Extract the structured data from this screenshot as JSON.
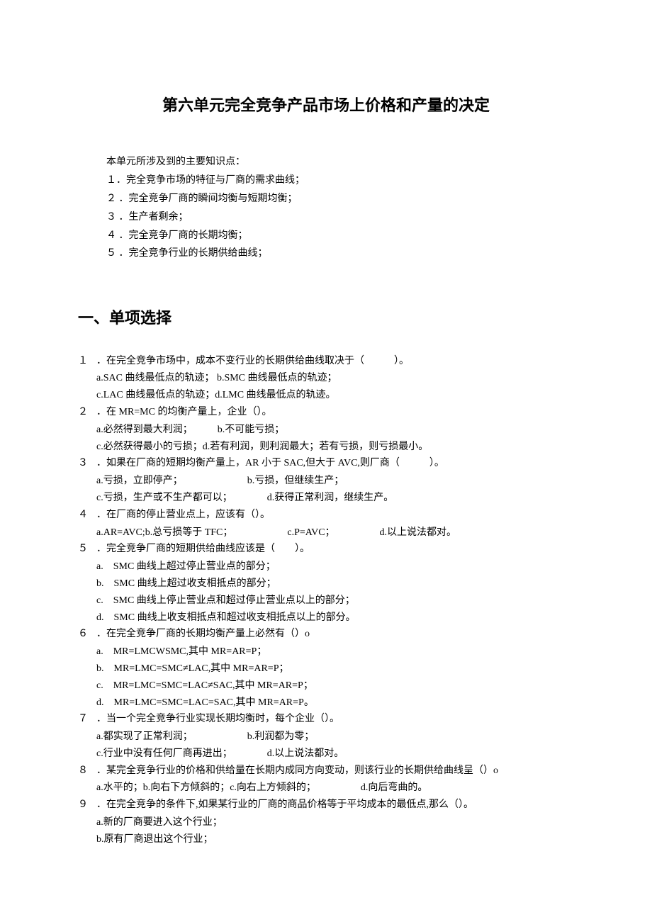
{
  "title": "第六单元完全竞争产品市场上价格和产量的决定",
  "intro": {
    "lead": "本单元所涉及到的主要知识点：",
    "items": [
      "１．完全竞争市场的特征与厂商的需求曲线；",
      "２ ．完全竞争厂商的瞬间均衡与短期均衡；",
      "３ ．生产者剩余；",
      "４ ．完全竞争厂商的长期均衡；",
      "５ ．完全竞争行业的长期供给曲线；"
    ]
  },
  "section_heading": "一、单项选择",
  "questions": [
    {
      "num": "１",
      "stem": "．在完全竞争市场中，成本不变行业的长期供给曲线取决于（　　　）。",
      "opts": [
        "a.SAC 曲线最低点的轨迹； b.SMC 曲线最低点的轨迹；",
        "c.LAC 曲线最低点的轨迹；d.LMC 曲线最低点的轨迹。"
      ]
    },
    {
      "num": "２",
      "stem": "．在 MR=MC 的均衡产量上，企业（）。",
      "opts": [
        "a.必然得到最大利润；　　　b.不可能亏损；",
        "c.必然获得最小的亏损；d.若有利润，则利润最大；若有亏损，则亏损最小。"
      ]
    },
    {
      "num": "３",
      "stem": "．如果在厂商的短期均衡产量上，AR 小于 SAC,但大于 AVC,则厂商（　　　）。",
      "opts": [
        "a.亏损，立即停产；　　　　　　　b.亏损，但继续生产；",
        "c.亏损，生产或不生产都可以；　　　　d.获得正常利润，继续生产。"
      ]
    },
    {
      "num": "４",
      "stem": "．在厂商的停止营业点上，应该有（）。",
      "opts": [
        "a.AR=AVC;b.总亏损等于 TFC；　　　　　　c.P=AVC；　　　　　d.以上说法都对。"
      ]
    },
    {
      "num": "５",
      "stem": "．完全竞争厂商的短期供给曲线应该是（　　）。",
      "opts": [
        "a.　SMC 曲线上超过停止营业点的部分；",
        "b.　SMC 曲线上超过收支相抵点的部分；",
        "c.　SMC 曲线上停止营业点和超过停止营业点以上的部分；",
        "d.　SMC 曲线上收支相抵点和超过收支相抵点以上的部分。"
      ]
    },
    {
      "num": "６",
      "stem": "．在完全竞争厂商的长期均衡产量上必然有（）o",
      "opts": [
        "a.　MR=LMCWSMC,其中 MR=AR=P；",
        "b.　MR=LMC=SMC≠LAC,其中 MR=AR=P；",
        "c.　MR=LMC=SMC=LAC≠SAC,其中 MR=AR=P；",
        "d.　MR=LMC=SMC=LAC=SAC,其中 MR=AR=P。"
      ]
    },
    {
      "num": "７",
      "stem": "．当一个完全竞争行业实现长期均衡时，每个企业（）。",
      "opts": [
        "a.都实现了正常利润；　　　　　　b.利润都为零；",
        "c.行业中没有任何厂商再进出；　　　　d.以上说法都对。"
      ]
    },
    {
      "num": "８",
      "stem": "．某完全竞争行业的价格和供给量在长期内成同方向变动，则该行业的长期供给曲线呈（）o",
      "opts": [
        "a.水平的；b.向右下方倾斜的；c.向右上方倾斜的；　　　　　d.向后弯曲的。"
      ]
    },
    {
      "num": "９",
      "stem": "．在完全竞争的条件下,如果某行业的厂商的商品价格等于平均成本的最低点,那么（）。",
      "opts": [
        "a.新的厂商要进入这个行业；",
        "b.原有厂商退出这个行业；"
      ]
    }
  ]
}
